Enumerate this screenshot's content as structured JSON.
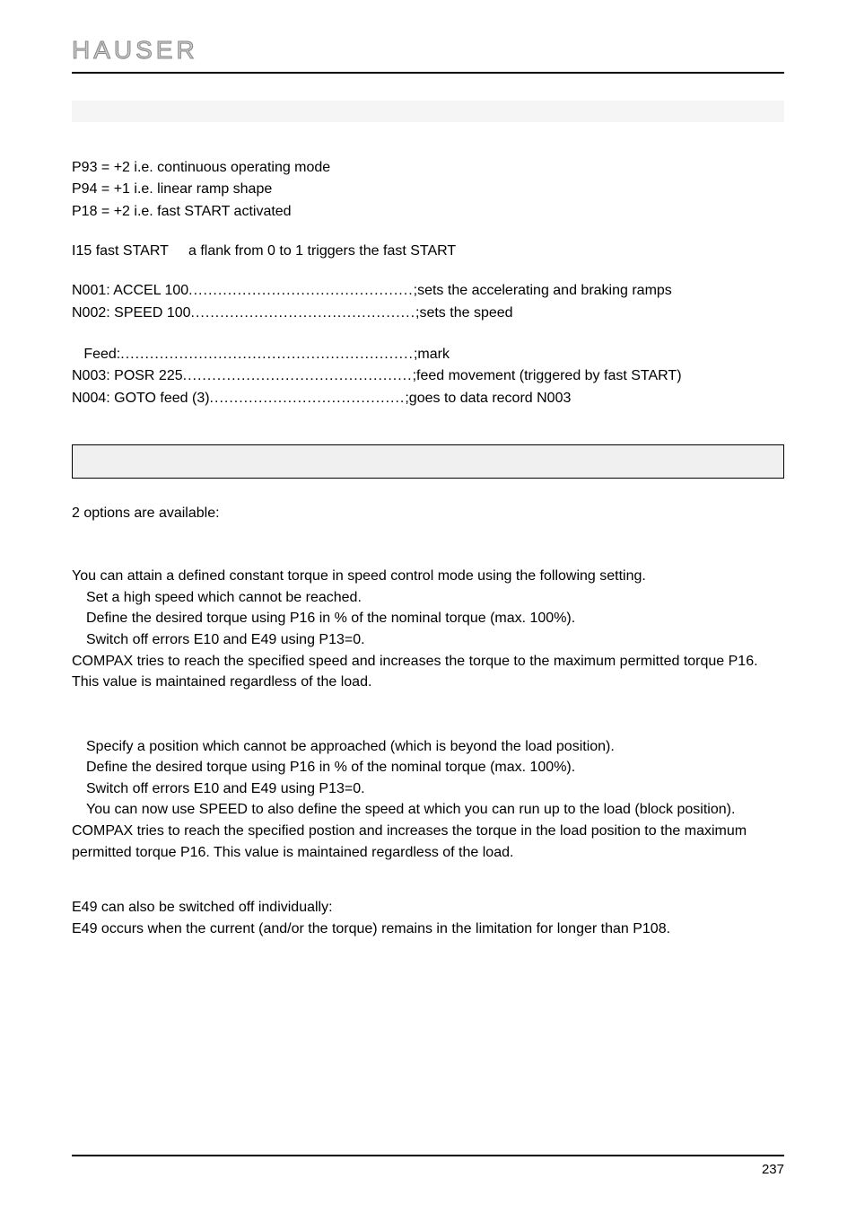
{
  "logo": "HAUSER",
  "parameters": {
    "p93": "P93 = +2 i.e. continuous operating mode",
    "p94": "P94 = +1 i.e. linear ramp shape",
    "p18": "P18 = +2 i.e. fast START activated"
  },
  "input": {
    "label": "I15  fast START",
    "desc": "a flank from 0 to 1 triggers the fast START"
  },
  "program1": [
    {
      "left": "N001: ACCEL 100",
      "right": ";sets the accelerating and braking ramps"
    },
    {
      "left": "N002: SPEED 100",
      "right": ";sets the speed"
    }
  ],
  "program2": [
    {
      "left": "   Feed:",
      "right": ";mark"
    },
    {
      "left": "N003: POSR 225 ",
      "right": ";feed movement (triggered by fast START)"
    },
    {
      "left": "N004: GOTO feed  (3)",
      "right": ";goes to data record N003"
    }
  ],
  "options_text": "2 options are available:",
  "option1": {
    "intro": "You can attain a defined constant torque in speed control mode using the following setting.",
    "bullets": [
      "Set a high speed which cannot be reached.",
      "Define the desired torque using P16 in % of the nominal torque (max. 100%).",
      "Switch off errors E10 and E49 using P13=0."
    ],
    "outro1": "COMPAX tries to reach the specified speed and increases the torque to the maximum permitted torque P16.",
    "outro2": "This value is maintained regardless of the load."
  },
  "option2": {
    "bullets": [
      "Specify a position which cannot be approached (which is beyond the load position).",
      "Define the desired torque using P16 in % of the nominal torque (max. 100%).",
      "Switch off errors E10 and E49 using P13=0.",
      "You can now use SPEED to also define the speed at which you can run up to the load (block position)."
    ],
    "outro1": "COMPAX tries to reach the specified postion and increases the torque in the load position to the maximum",
    "outro2": "permitted torque P16. This value is maintained regardless of the load."
  },
  "note": {
    "line1": "E49 can also be switched off individually:",
    "line2": "E49 occurs when the current (and/or the torque) remains in the limitation for longer than P108."
  },
  "page_number": "237"
}
